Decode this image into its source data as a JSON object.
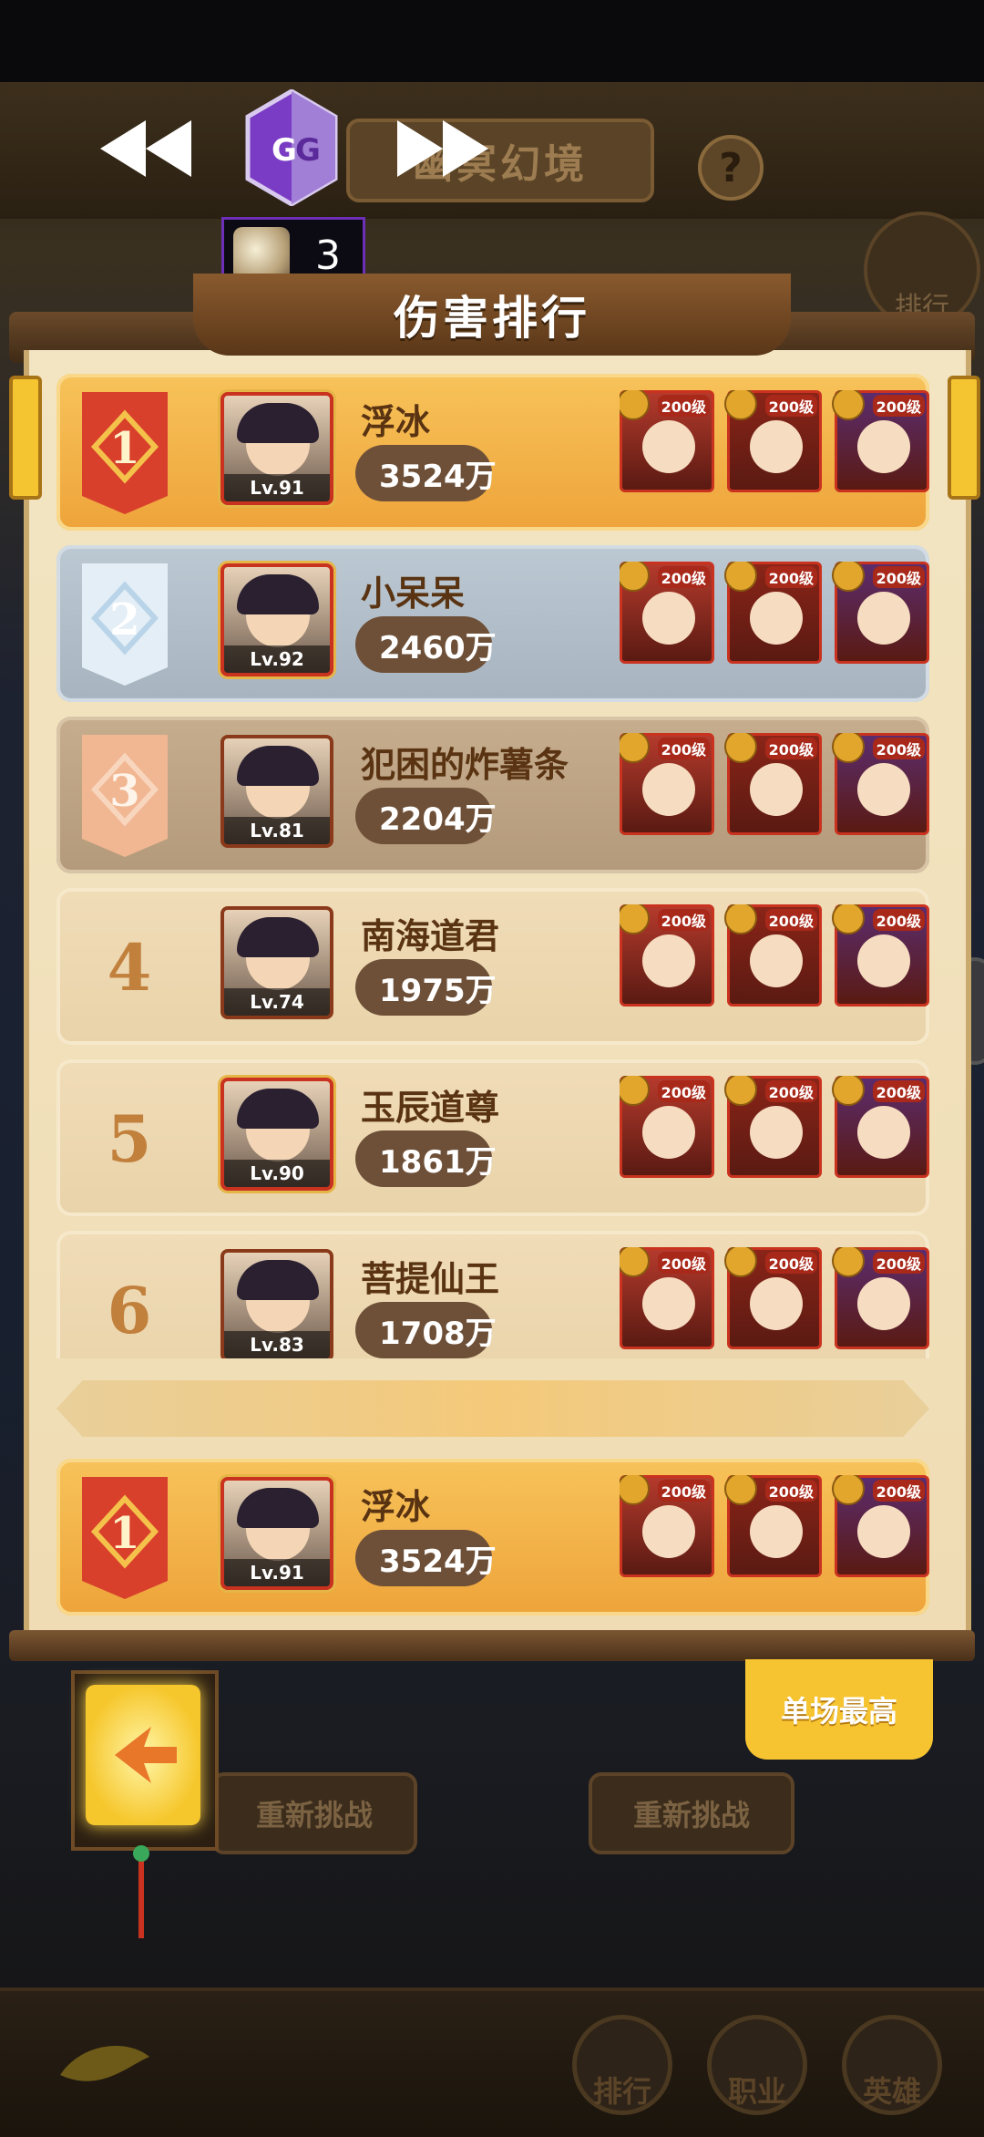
{
  "header": {
    "stage_title": "幽冥幻境",
    "help_label": "?",
    "stone_count": "3",
    "side_button_label": "排行"
  },
  "panel": {
    "title": "伤害排行"
  },
  "rankings": [
    {
      "rank": "1",
      "name": "浮冰",
      "level": "Lv.91",
      "score": "3524万",
      "heroes": [
        "200级",
        "200级",
        "200级"
      ]
    },
    {
      "rank": "2",
      "name": "小呆呆",
      "level": "Lv.92",
      "score": "2460万",
      "heroes": [
        "200级",
        "200级",
        "200级"
      ]
    },
    {
      "rank": "3",
      "name": "犯困的炸薯条",
      "level": "Lv.81",
      "score": "2204万",
      "heroes": [
        "200级",
        "200级",
        "200级"
      ]
    },
    {
      "rank": "4",
      "name": "南海道君",
      "level": "Lv.74",
      "score": "1975万",
      "heroes": [
        "200级",
        "200级",
        "200级"
      ]
    },
    {
      "rank": "5",
      "name": "玉辰道尊",
      "level": "Lv.90",
      "score": "1861万",
      "heroes": [
        "200级",
        "200级",
        "200级"
      ]
    },
    {
      "rank": "6",
      "name": "菩提仙王",
      "level": "Lv.83",
      "score": "1708万",
      "heroes": [
        "200级",
        "200级",
        "200级"
      ]
    }
  ],
  "my_rank": {
    "rank": "1",
    "name": "浮冰",
    "level": "Lv.91",
    "score": "3524万",
    "heroes": [
      "200级",
      "200级",
      "200级"
    ]
  },
  "footer": {
    "single_best_label": "单场最高",
    "retry_label_1": "重新挑战",
    "retry_label_2": "重新挑战"
  },
  "bottom_nav": {
    "rank": "排行",
    "class": "职业",
    "hero": "英雄"
  },
  "colors": {
    "gold_row": "#f7c35a",
    "silver_row": "#bcc8d2",
    "bronze_row": "#c6ad8e",
    "plain_row": "#f0dcb7",
    "accent_red": "#c9321f",
    "gg_purple": "#6e2fb8"
  }
}
